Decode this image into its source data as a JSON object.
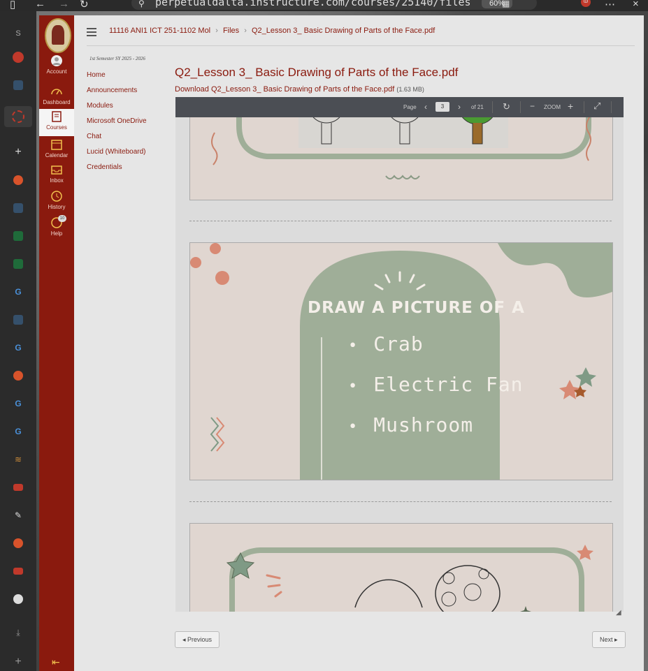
{
  "browser": {
    "url": "perpetualdalta.instructure.com/courses/25140/files",
    "zoom": "60%"
  },
  "global_nav": {
    "items": [
      {
        "label": "Account"
      },
      {
        "label": "Dashboard"
      },
      {
        "label": "Courses"
      },
      {
        "label": "Calendar"
      },
      {
        "label": "Inbox"
      },
      {
        "label": "History"
      },
      {
        "label": "Help",
        "badge": "10"
      }
    ]
  },
  "breadcrumb": {
    "course": "11116 ANI1 ICT 251-1102 Mol",
    "section": "Files",
    "file": "Q2_Lesson 3_ Basic Drawing of Parts of the Face.pdf"
  },
  "semester": "1st Semester SY 2025 - 2026",
  "course_nav": [
    "Home",
    "Announcements",
    "Modules",
    "Microsoft OneDrive",
    "Chat",
    "Lucid (Whiteboard)",
    "Credentials"
  ],
  "file": {
    "title": "Q2_Lesson 3_ Basic Drawing of Parts of the Face.pdf",
    "download_label": "Download Q2_Lesson 3_ Basic Drawing of Parts of the Face.pdf",
    "size": "(1.63 MB)"
  },
  "viewer": {
    "page_label": "Page",
    "current_page": "3",
    "of_total": "of 21",
    "zoom_label": "ZOOM"
  },
  "slide": {
    "heading": "DRAW A PICTURE OF A",
    "items": [
      "Crab",
      "Electric Fan",
      "Mushroom"
    ]
  },
  "pagination": {
    "previous": "Previous",
    "next": "Next"
  },
  "colors": {
    "brand": "#8a1a0e",
    "slide_green": "#9fae98",
    "slide_bg": "#e0d6d0"
  }
}
